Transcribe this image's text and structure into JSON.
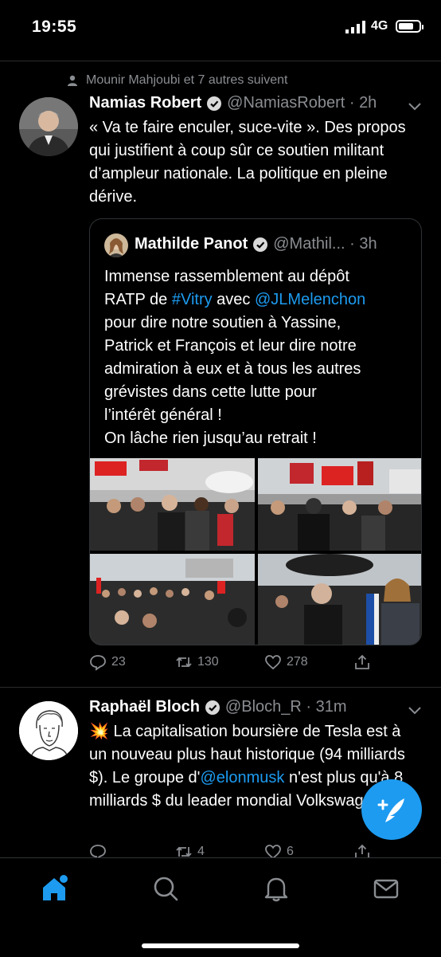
{
  "status_bar": {
    "time": "19:55",
    "network": "4G",
    "battery_level": 0.75
  },
  "tweets": [
    {
      "social_context": "Mounir Mahjoubi et 7 autres suivent",
      "name": "Namias Robert",
      "verified": true,
      "handle": "@NamiasRobert",
      "time": "2h",
      "text": "« Va te faire enculer, suce-vite ». Des propos qui justifient à coup sûr ce soutien militant d’ampleur nationale. La politique en pleine dérive.",
      "quote": {
        "name": "Mathilde Panot",
        "verified": true,
        "handle": "@Mathil...",
        "time": "3h",
        "text_lines": [
          "Immense rassemblement au dépôt",
          "RATP de #Vitry avec @JLMelenchon",
          "pour dire notre soutien à Yassine,",
          "Patrick et François et leur dire notre",
          "admiration à eux et à tous les autres",
          "grévistes dans cette lutte pour",
          "l’intérêt général !",
          "On lâche rien jusqu’au retrait !"
        ],
        "photos": 4
      },
      "actions": {
        "replies": "23",
        "retweets": "130",
        "likes": "278"
      }
    },
    {
      "name": "Raphaël Bloch",
      "verified": true,
      "handle": "@Bloch_R",
      "time": "31m",
      "emoji": "💥",
      "text_part1": " La capitalisation boursière de Tesla est à un nouveau plus haut historique (94 milliards $). Le groupe d'",
      "mention": "@elonmusk",
      "text_part2": " n'est plus qu'à 8 milliards $ du leader mondial Volkswagen.",
      "actions": {
        "replies": "",
        "retweets": "4",
        "likes": "6"
      }
    }
  ],
  "tab_bar": [
    "home-icon",
    "search-icon",
    "notifications-icon",
    "messages-icon"
  ],
  "colors": {
    "accent": "#1d9bf0",
    "muted": "#8a8d91",
    "background": "#000000"
  }
}
